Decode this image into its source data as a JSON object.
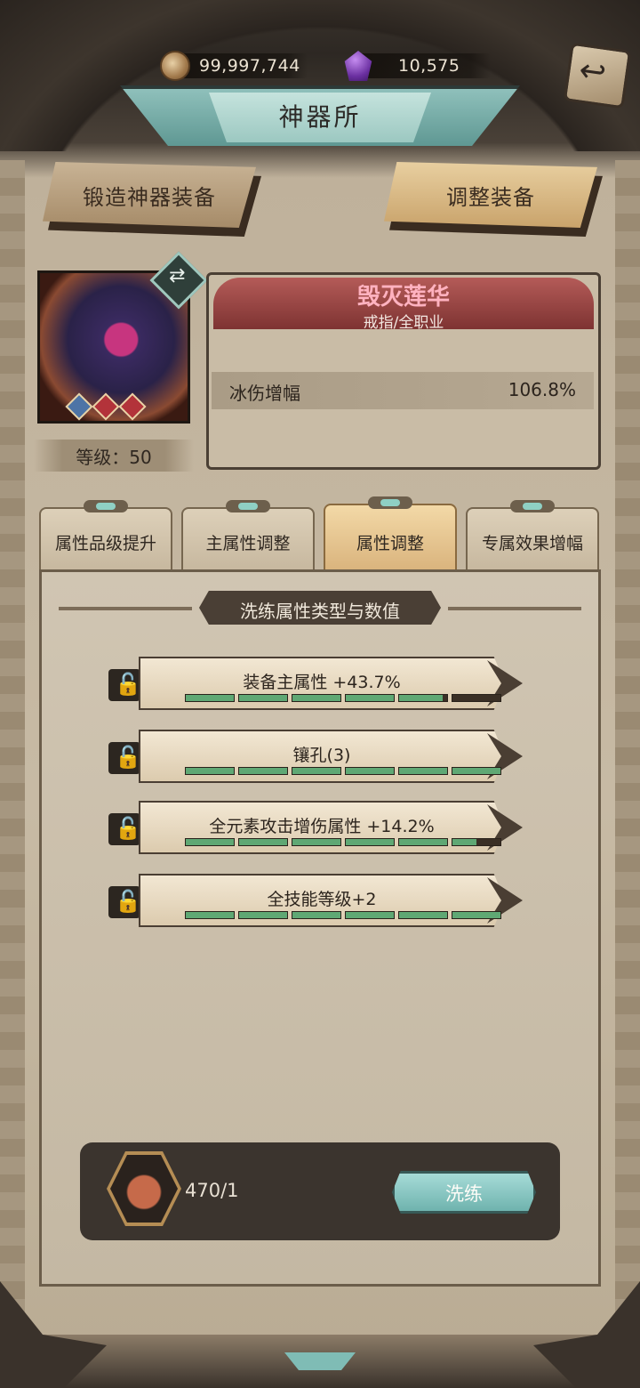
{
  "currency": {
    "coins": "99,997,744",
    "gems": "10,575"
  },
  "header": {
    "title": "神器所"
  },
  "top_buttons": {
    "forge_label": "锻造神器装备",
    "adjust_label": "调整装备"
  },
  "equipment": {
    "level_text": "等级：50",
    "name": "毁灭莲华",
    "type": "戒指/全职业",
    "stat_name": "冰伤增幅",
    "stat_value": "106.8%",
    "gems": [
      "blue",
      "red",
      "red"
    ]
  },
  "tabs": [
    {
      "label": "属性品级提升",
      "active": false
    },
    {
      "label": "主属性调整",
      "active": false
    },
    {
      "label": "属性调整",
      "active": true
    },
    {
      "label": "专属效果增幅",
      "active": false
    }
  ],
  "section_title": "洗练属性类型与数值",
  "attributes": [
    {
      "text": "装备主属性 +43.7%",
      "fill": [
        1,
        1,
        1,
        1,
        0.9,
        0
      ]
    },
    {
      "text": "镶孔(3)",
      "fill": [
        1,
        1,
        1,
        1,
        1,
        1
      ]
    },
    {
      "text": "全元素攻击增伤属性 +14.2%",
      "fill": [
        1,
        1,
        1,
        1,
        1,
        0.5
      ]
    },
    {
      "text": "全技能等级+2",
      "fill": [
        1,
        1,
        1,
        1,
        1,
        1
      ]
    }
  ],
  "cost": {
    "count": "470/1",
    "icon": "potion-icon"
  },
  "refine_button": {
    "label": "洗练"
  },
  "colors": {
    "name_pink": "#ffb2c0",
    "bar_fill": "#5fa874",
    "refine_teal": "#8ccbc6"
  }
}
